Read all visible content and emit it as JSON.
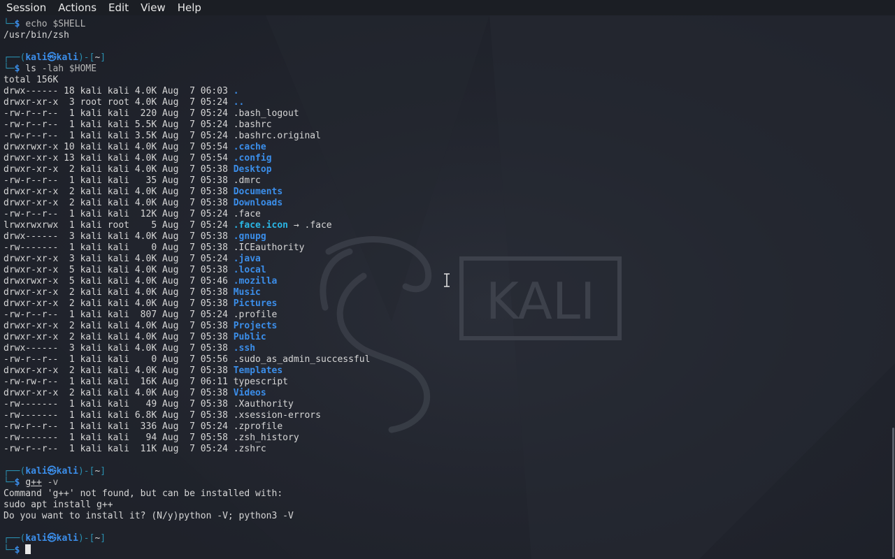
{
  "menu": [
    "Session",
    "Actions",
    "Edit",
    "View",
    "Help"
  ],
  "wallpaper": {
    "logo_text": "KALI"
  },
  "prompt": {
    "user": "kali",
    "host": "kali",
    "dir": "~",
    "symbol": "$"
  },
  "shell_path": "/usr/bin/zsh",
  "commands": {
    "echo": "echo $SHELL",
    "ls_cmd": "ls",
    "ls_args": " -lah $HOME",
    "gpp_cmd": "g++",
    "gpp_args": " -v"
  },
  "ls_total": "total 156K",
  "ls_entries": [
    {
      "perm": "drwx------",
      "links": "18",
      "owner": "kali",
      "group": "kali",
      "size": "4.0K",
      "month": "Aug",
      "day": "7",
      "time": "06:03",
      "name": ".",
      "type": "dir"
    },
    {
      "perm": "drwxr-xr-x",
      "links": "3",
      "owner": "root",
      "group": "root",
      "size": "4.0K",
      "month": "Aug",
      "day": "7",
      "time": "05:24",
      "name": "..",
      "type": "dir"
    },
    {
      "perm": "-rw-r--r--",
      "links": "1",
      "owner": "kali",
      "group": "kali",
      "size": "220",
      "month": "Aug",
      "day": "7",
      "time": "05:24",
      "name": ".bash_logout",
      "type": "file"
    },
    {
      "perm": "-rw-r--r--",
      "links": "1",
      "owner": "kali",
      "group": "kali",
      "size": "5.5K",
      "month": "Aug",
      "day": "7",
      "time": "05:24",
      "name": ".bashrc",
      "type": "file"
    },
    {
      "perm": "-rw-r--r--",
      "links": "1",
      "owner": "kali",
      "group": "kali",
      "size": "3.5K",
      "month": "Aug",
      "day": "7",
      "time": "05:24",
      "name": ".bashrc.original",
      "type": "file"
    },
    {
      "perm": "drwxrwxr-x",
      "links": "10",
      "owner": "kali",
      "group": "kali",
      "size": "4.0K",
      "month": "Aug",
      "day": "7",
      "time": "05:54",
      "name": ".cache",
      "type": "dir"
    },
    {
      "perm": "drwxr-xr-x",
      "links": "13",
      "owner": "kali",
      "group": "kali",
      "size": "4.0K",
      "month": "Aug",
      "day": "7",
      "time": "05:54",
      "name": ".config",
      "type": "dir"
    },
    {
      "perm": "drwxr-xr-x",
      "links": "2",
      "owner": "kali",
      "group": "kali",
      "size": "4.0K",
      "month": "Aug",
      "day": "7",
      "time": "05:38",
      "name": "Desktop",
      "type": "dir"
    },
    {
      "perm": "-rw-r--r--",
      "links": "1",
      "owner": "kali",
      "group": "kali",
      "size": "35",
      "month": "Aug",
      "day": "7",
      "time": "05:38",
      "name": ".dmrc",
      "type": "file"
    },
    {
      "perm": "drwxr-xr-x",
      "links": "2",
      "owner": "kali",
      "group": "kali",
      "size": "4.0K",
      "month": "Aug",
      "day": "7",
      "time": "05:38",
      "name": "Documents",
      "type": "dir"
    },
    {
      "perm": "drwxr-xr-x",
      "links": "2",
      "owner": "kali",
      "group": "kali",
      "size": "4.0K",
      "month": "Aug",
      "day": "7",
      "time": "05:38",
      "name": "Downloads",
      "type": "dir"
    },
    {
      "perm": "-rw-r--r--",
      "links": "1",
      "owner": "kali",
      "group": "kali",
      "size": "12K",
      "month": "Aug",
      "day": "7",
      "time": "05:24",
      "name": ".face",
      "type": "file"
    },
    {
      "perm": "lrwxrwxrwx",
      "links": "1",
      "owner": "kali",
      "group": "root",
      "size": "5",
      "month": "Aug",
      "day": "7",
      "time": "05:24",
      "name": ".face.icon",
      "type": "link",
      "target": ".face"
    },
    {
      "perm": "drwx------",
      "links": "3",
      "owner": "kali",
      "group": "kali",
      "size": "4.0K",
      "month": "Aug",
      "day": "7",
      "time": "05:38",
      "name": ".gnupg",
      "type": "dir"
    },
    {
      "perm": "-rw-------",
      "links": "1",
      "owner": "kali",
      "group": "kali",
      "size": "0",
      "month": "Aug",
      "day": "7",
      "time": "05:38",
      "name": ".ICEauthority",
      "type": "file"
    },
    {
      "perm": "drwxr-xr-x",
      "links": "3",
      "owner": "kali",
      "group": "kali",
      "size": "4.0K",
      "month": "Aug",
      "day": "7",
      "time": "05:24",
      "name": ".java",
      "type": "dir"
    },
    {
      "perm": "drwxr-xr-x",
      "links": "5",
      "owner": "kali",
      "group": "kali",
      "size": "4.0K",
      "month": "Aug",
      "day": "7",
      "time": "05:38",
      "name": ".local",
      "type": "dir"
    },
    {
      "perm": "drwxrwxr-x",
      "links": "5",
      "owner": "kali",
      "group": "kali",
      "size": "4.0K",
      "month": "Aug",
      "day": "7",
      "time": "05:46",
      "name": ".mozilla",
      "type": "dir"
    },
    {
      "perm": "drwxr-xr-x",
      "links": "2",
      "owner": "kali",
      "group": "kali",
      "size": "4.0K",
      "month": "Aug",
      "day": "7",
      "time": "05:38",
      "name": "Music",
      "type": "dir"
    },
    {
      "perm": "drwxr-xr-x",
      "links": "2",
      "owner": "kali",
      "group": "kali",
      "size": "4.0K",
      "month": "Aug",
      "day": "7",
      "time": "05:38",
      "name": "Pictures",
      "type": "dir"
    },
    {
      "perm": "-rw-r--r--",
      "links": "1",
      "owner": "kali",
      "group": "kali",
      "size": "807",
      "month": "Aug",
      "day": "7",
      "time": "05:24",
      "name": ".profile",
      "type": "file"
    },
    {
      "perm": "drwxr-xr-x",
      "links": "2",
      "owner": "kali",
      "group": "kali",
      "size": "4.0K",
      "month": "Aug",
      "day": "7",
      "time": "05:38",
      "name": "Projects",
      "type": "dir"
    },
    {
      "perm": "drwxr-xr-x",
      "links": "2",
      "owner": "kali",
      "group": "kali",
      "size": "4.0K",
      "month": "Aug",
      "day": "7",
      "time": "05:38",
      "name": "Public",
      "type": "dir"
    },
    {
      "perm": "drwx------",
      "links": "3",
      "owner": "kali",
      "group": "kali",
      "size": "4.0K",
      "month": "Aug",
      "day": "7",
      "time": "05:38",
      "name": ".ssh",
      "type": "dir"
    },
    {
      "perm": "-rw-r--r--",
      "links": "1",
      "owner": "kali",
      "group": "kali",
      "size": "0",
      "month": "Aug",
      "day": "7",
      "time": "05:56",
      "name": ".sudo_as_admin_successful",
      "type": "file"
    },
    {
      "perm": "drwxr-xr-x",
      "links": "2",
      "owner": "kali",
      "group": "kali",
      "size": "4.0K",
      "month": "Aug",
      "day": "7",
      "time": "05:38",
      "name": "Templates",
      "type": "dir"
    },
    {
      "perm": "-rw-rw-r--",
      "links": "1",
      "owner": "kali",
      "group": "kali",
      "size": "16K",
      "month": "Aug",
      "day": "7",
      "time": "06:11",
      "name": "typescript",
      "type": "file"
    },
    {
      "perm": "drwxr-xr-x",
      "links": "2",
      "owner": "kali",
      "group": "kali",
      "size": "4.0K",
      "month": "Aug",
      "day": "7",
      "time": "05:38",
      "name": "Videos",
      "type": "dir"
    },
    {
      "perm": "-rw-------",
      "links": "1",
      "owner": "kali",
      "group": "kali",
      "size": "49",
      "month": "Aug",
      "day": "7",
      "time": "05:38",
      "name": ".Xauthority",
      "type": "file"
    },
    {
      "perm": "-rw-------",
      "links": "1",
      "owner": "kali",
      "group": "kali",
      "size": "6.8K",
      "month": "Aug",
      "day": "7",
      "time": "05:38",
      "name": ".xsession-errors",
      "type": "file"
    },
    {
      "perm": "-rw-r--r--",
      "links": "1",
      "owner": "kali",
      "group": "kali",
      "size": "336",
      "month": "Aug",
      "day": "7",
      "time": "05:24",
      "name": ".zprofile",
      "type": "file"
    },
    {
      "perm": "-rw-------",
      "links": "1",
      "owner": "kali",
      "group": "kali",
      "size": "94",
      "month": "Aug",
      "day": "7",
      "time": "05:58",
      "name": ".zsh_history",
      "type": "file"
    },
    {
      "perm": "-rw-r--r--",
      "links": "1",
      "owner": "kali",
      "group": "kali",
      "size": "11K",
      "month": "Aug",
      "day": "7",
      "time": "05:24",
      "name": ".zshrc",
      "type": "file"
    }
  ],
  "gpp_output": [
    "Command 'g++' not found, but can be installed with:",
    "sudo apt install g++",
    "Do you want to install it? (N/y)python -V; python3 -V"
  ],
  "colors": {
    "directory": "#3b8eea",
    "prompt_frame": "#2a8fb0",
    "text": "#d6d6d6",
    "background": "#1d2029"
  },
  "icons": {
    "link_arrow": "→",
    "at_symbol": "㉿",
    "cursor": "ibeam-cursor-icon"
  }
}
